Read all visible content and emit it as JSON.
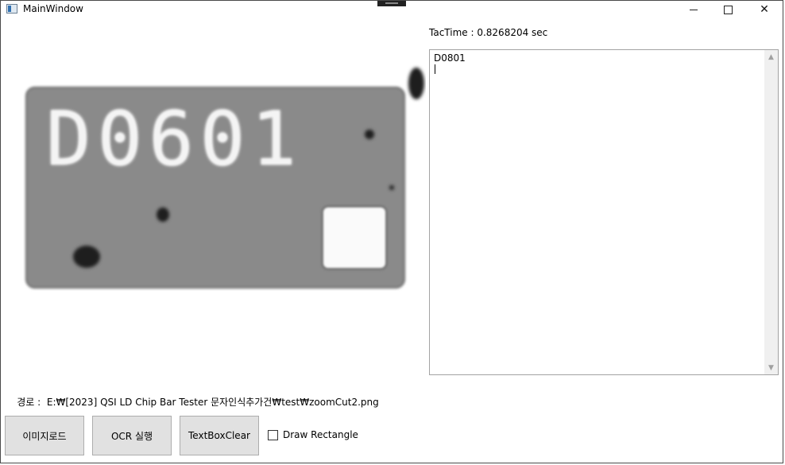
{
  "window": {
    "title": "MainWindow",
    "controls": {
      "minimize_icon": "minimize-icon",
      "maximize_icon": "maximize-icon",
      "close_icon": "close-icon"
    }
  },
  "tactime": {
    "text": "TacTime : 0.8268204 sec"
  },
  "image_panel": {
    "chip_label": "D0601"
  },
  "output": {
    "lines": "D0801\n"
  },
  "path": {
    "label": "경로 :",
    "value": "E:₩[2023] QSI LD Chip Bar Tester 문자인식추가건₩test₩zoomCut2.png"
  },
  "buttons": {
    "load_image": "이미지로드",
    "run_ocr": "OCR 실행",
    "clear_text": "TextBoxClear"
  },
  "checkbox": {
    "label": "Draw Rectangle",
    "checked": false
  }
}
